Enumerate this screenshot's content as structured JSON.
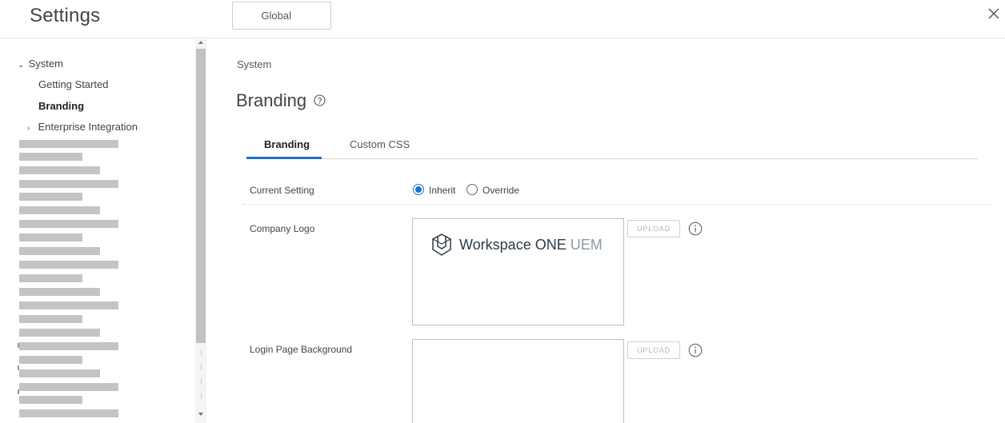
{
  "header": {
    "title": "Settings",
    "org_group": "Global",
    "close_icon": "close-icon"
  },
  "sidebar": {
    "system_label": "System",
    "getting_started_label": "Getting Started",
    "branding_label": "Branding",
    "enterprise_integration_label": "Enterprise Integration"
  },
  "main": {
    "breadcrumb": "System",
    "title": "Branding",
    "tabs": [
      {
        "label": "Branding"
      },
      {
        "label": "Custom CSS"
      }
    ],
    "current_setting": {
      "label": "Current Setting",
      "options": [
        "Inherit",
        "Override"
      ],
      "selected": "Inherit"
    },
    "company_logo": {
      "label": "Company Logo",
      "upload_label": "UPLOAD",
      "logo_text_main": "Workspace ONE",
      "logo_text_accent": "UEM"
    },
    "login_background": {
      "label": "Login Page Background",
      "upload_label": "UPLOAD"
    }
  },
  "colors": {
    "accent": "#1a73c8",
    "placeholder": "#c4c4c4",
    "logo_dark": "#2b3a46",
    "logo_accent": "#8a9aa6"
  }
}
